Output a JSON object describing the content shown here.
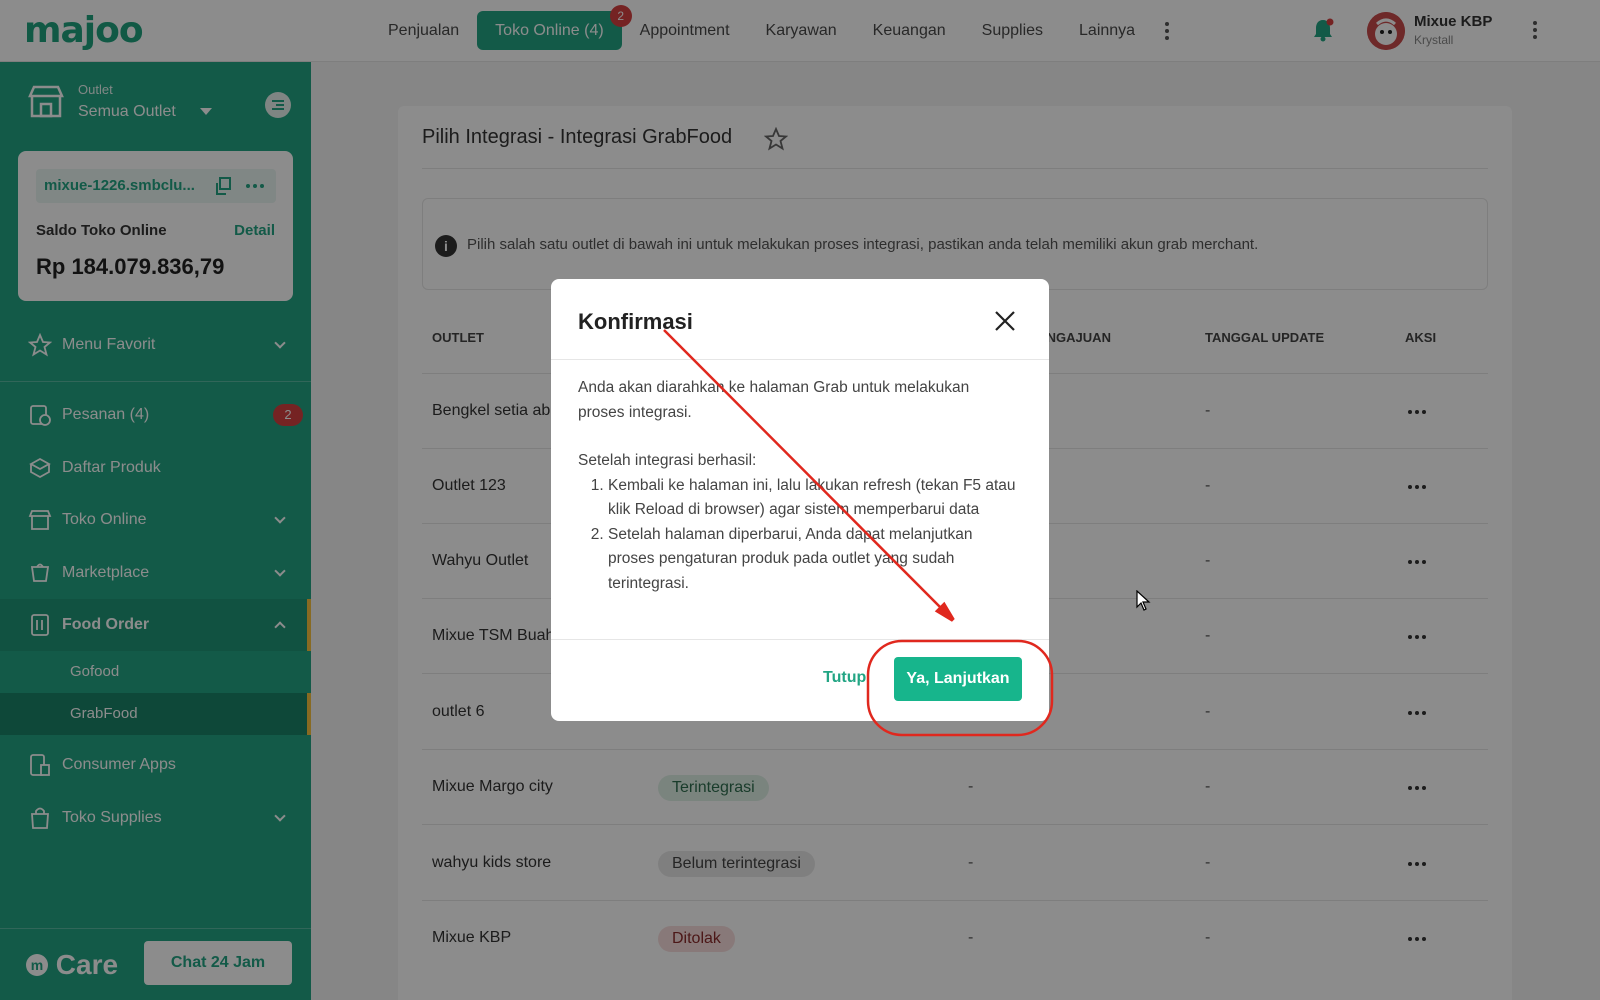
{
  "topbar": {
    "logo": "majoo",
    "nav": [
      {
        "label": "Penjualan"
      },
      {
        "label": "Toko Online (4)",
        "badge": "2",
        "active": true
      },
      {
        "label": "Appointment"
      },
      {
        "label": "Karyawan"
      },
      {
        "label": "Keuangan"
      },
      {
        "label": "Supplies"
      },
      {
        "label": "Lainnya"
      }
    ],
    "user_name": "Mixue KBP",
    "user_sub": "Krystall"
  },
  "sidebar": {
    "outlet_label": "Outlet",
    "outlet_value": "Semua Outlet",
    "shop_url": "mixue-1226.smbclu...",
    "saldo_label": "Saldo Toko Online",
    "saldo_detail": "Detail",
    "saldo_value": "Rp 184.079.836,79",
    "menu": [
      {
        "label": "Menu Favorit",
        "icon": "star-icon"
      },
      {
        "label": "Pesanan (4)",
        "icon": "order-icon",
        "badge": "2"
      },
      {
        "label": "Daftar Produk",
        "icon": "box-icon"
      },
      {
        "label": "Toko Online",
        "icon": "store-icon"
      },
      {
        "label": "Marketplace",
        "icon": "marketplace-icon"
      },
      {
        "label": "Food Order",
        "icon": "food-order-icon"
      },
      {
        "label": "Consumer Apps",
        "icon": "consumer-apps-icon"
      },
      {
        "label": "Toko Supplies",
        "icon": "bag-icon"
      }
    ],
    "food_order_sub": [
      "Gofood",
      "GrabFood"
    ],
    "care_logo": "Care",
    "chat_button": "Chat 24 Jam"
  },
  "main": {
    "title": "Pilih Integrasi - Integrasi GrabFood",
    "info": "Pilih salah satu outlet di bawah ini untuk melakukan proses integrasi, pastikan anda telah memiliki akun grab merchant.",
    "headers": [
      "OUTLET",
      "ENGAJUAN",
      "TANGGAL UPDATE",
      "AKSI"
    ],
    "rows": [
      {
        "outlet": "Bengkel setia ab",
        "status": "",
        "pengajuan": "",
        "update": "-"
      },
      {
        "outlet": "Outlet 123",
        "status": "",
        "pengajuan": "",
        "update": "-"
      },
      {
        "outlet": "Wahyu Outlet",
        "status": "",
        "pengajuan": "",
        "update": "-"
      },
      {
        "outlet": "Mixue TSM Buah",
        "status": "",
        "pengajuan": "",
        "update": "-"
      },
      {
        "outlet": "outlet 6",
        "status": "",
        "pengajuan": "",
        "update": "-"
      },
      {
        "outlet": "Mixue Margo city",
        "status": "Terintegrasi",
        "pengajuan": "-",
        "update": "-"
      },
      {
        "outlet": "wahyu kids store",
        "status": "Belum terintegrasi",
        "pengajuan": "-",
        "update": "-"
      },
      {
        "outlet": "Mixue KBP",
        "status": "Ditolak",
        "pengajuan": "-",
        "update": "-"
      }
    ]
  },
  "modal": {
    "title": "Konfirmasi",
    "intro": "Anda akan diarahkan ke halaman Grab untuk melakukan proses integrasi.",
    "after_label": "Setelah integrasi berhasil:",
    "steps": [
      "Kembali ke halaman ini, lalu lakukan refresh (tekan F5 atau klik Reload di browser) agar sistem memperbarui data",
      "Setelah halaman diperbarui, Anda dapat melanjutkan proses pengaturan produk pada outlet yang sudah terintegrasi."
    ],
    "cancel": "Tutup",
    "confirm": "Ya, Lanjutkan"
  },
  "colors": {
    "brand": "#23a584",
    "badge_red": "#d64040",
    "annotation": "#e0281e"
  }
}
